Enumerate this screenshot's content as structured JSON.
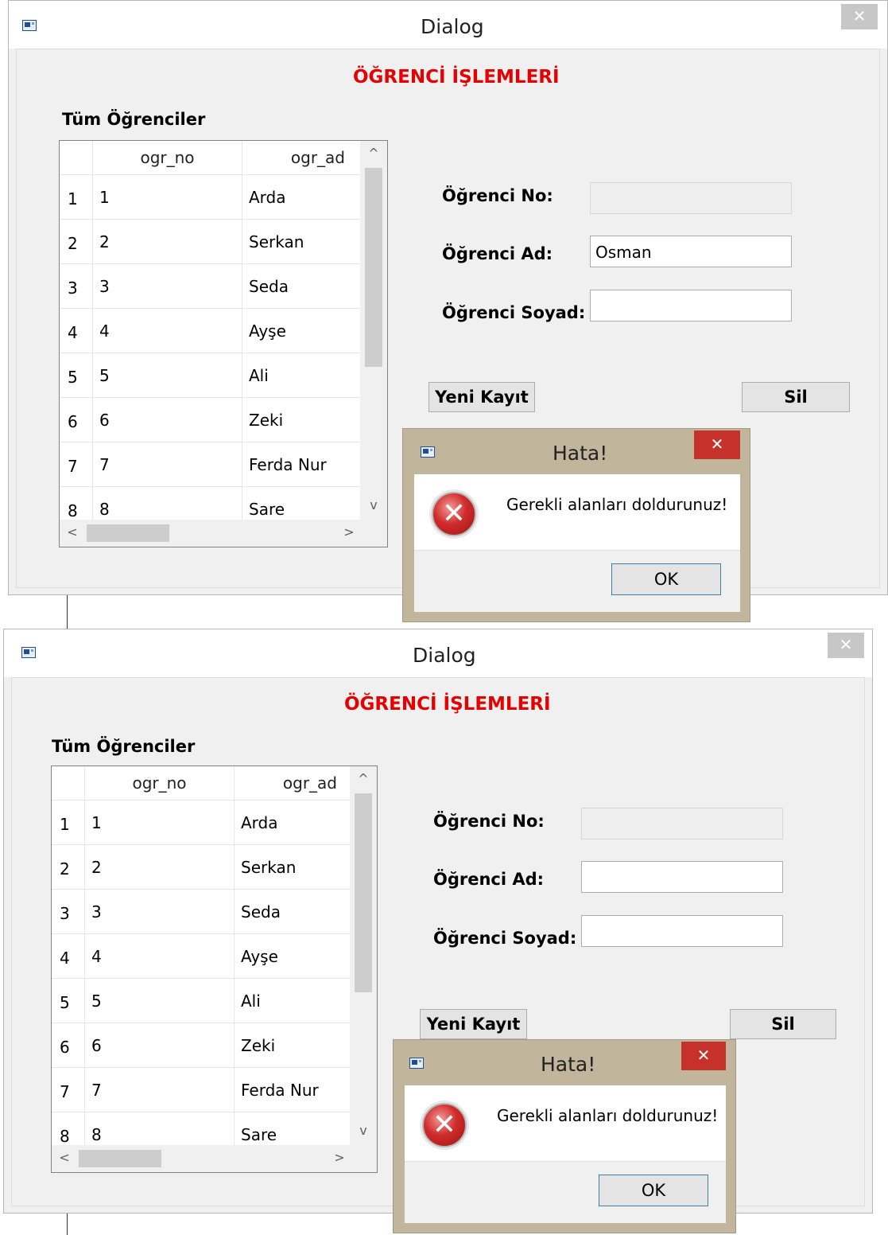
{
  "shots": [
    {
      "window": {
        "title": "Dialog",
        "close_glyph": "✕",
        "icon": "app-window-icon"
      },
      "heading": "ÖĞRENCİ İŞLEMLERİ",
      "section_label": "Tüm Öğrenciler",
      "table": {
        "columns": [
          "ogr_no",
          "ogr_ad"
        ],
        "rows": [
          {
            "n": "1",
            "ogr_no": "1",
            "ogr_ad": "Arda"
          },
          {
            "n": "2",
            "ogr_no": "2",
            "ogr_ad": "Serkan"
          },
          {
            "n": "3",
            "ogr_no": "3",
            "ogr_ad": "Seda"
          },
          {
            "n": "4",
            "ogr_no": "4",
            "ogr_ad": "Ayşe"
          },
          {
            "n": "5",
            "ogr_no": "5",
            "ogr_ad": "Ali"
          },
          {
            "n": "6",
            "ogr_no": "6",
            "ogr_ad": "Zeki"
          },
          {
            "n": "7",
            "ogr_no": "7",
            "ogr_ad": "Ferda Nur"
          },
          {
            "n": "8",
            "ogr_no": "8",
            "ogr_ad": "Sare"
          }
        ]
      },
      "form": {
        "no_label": "Öğrenci No:",
        "ad_label": "Öğrenci Ad:",
        "soyad_label": "Öğrenci Soyad:",
        "no_value": "",
        "ad_value": "Osman",
        "soyad_value": ""
      },
      "buttons": {
        "new": "Yeni Kayıt",
        "delete": "Sil"
      },
      "message": {
        "title": "Hata!",
        "text": "Gerekli alanları doldurunuz!",
        "ok": "OK",
        "close_glyph": "✕",
        "icon_glyph": "✕"
      }
    },
    {
      "window": {
        "title": "Dialog",
        "close_glyph": "✕",
        "icon": "app-window-icon"
      },
      "heading": "ÖĞRENCİ İŞLEMLERİ",
      "section_label": "Tüm Öğrenciler",
      "table": {
        "columns": [
          "ogr_no",
          "ogr_ad"
        ],
        "rows": [
          {
            "n": "1",
            "ogr_no": "1",
            "ogr_ad": "Arda"
          },
          {
            "n": "2",
            "ogr_no": "2",
            "ogr_ad": "Serkan"
          },
          {
            "n": "3",
            "ogr_no": "3",
            "ogr_ad": "Seda"
          },
          {
            "n": "4",
            "ogr_no": "4",
            "ogr_ad": "Ayşe"
          },
          {
            "n": "5",
            "ogr_no": "5",
            "ogr_ad": "Ali"
          },
          {
            "n": "6",
            "ogr_no": "6",
            "ogr_ad": "Zeki"
          },
          {
            "n": "7",
            "ogr_no": "7",
            "ogr_ad": "Ferda Nur"
          },
          {
            "n": "8",
            "ogr_no": "8",
            "ogr_ad": "Sare"
          }
        ]
      },
      "form": {
        "no_label": "Öğrenci No:",
        "ad_label": "Öğrenci Ad:",
        "soyad_label": "Öğrenci Soyad:",
        "no_value": "",
        "ad_value": "",
        "soyad_value": ""
      },
      "buttons": {
        "new": "Yeni Kayıt",
        "delete": "Sil"
      },
      "message": {
        "title": "Hata!",
        "text": "Gerekli alanları doldurunuz!",
        "ok": "OK",
        "close_glyph": "✕",
        "icon_glyph": "✕"
      }
    }
  ],
  "scroll": {
    "up": "^",
    "down": "v",
    "left": "<",
    "right": ">"
  }
}
